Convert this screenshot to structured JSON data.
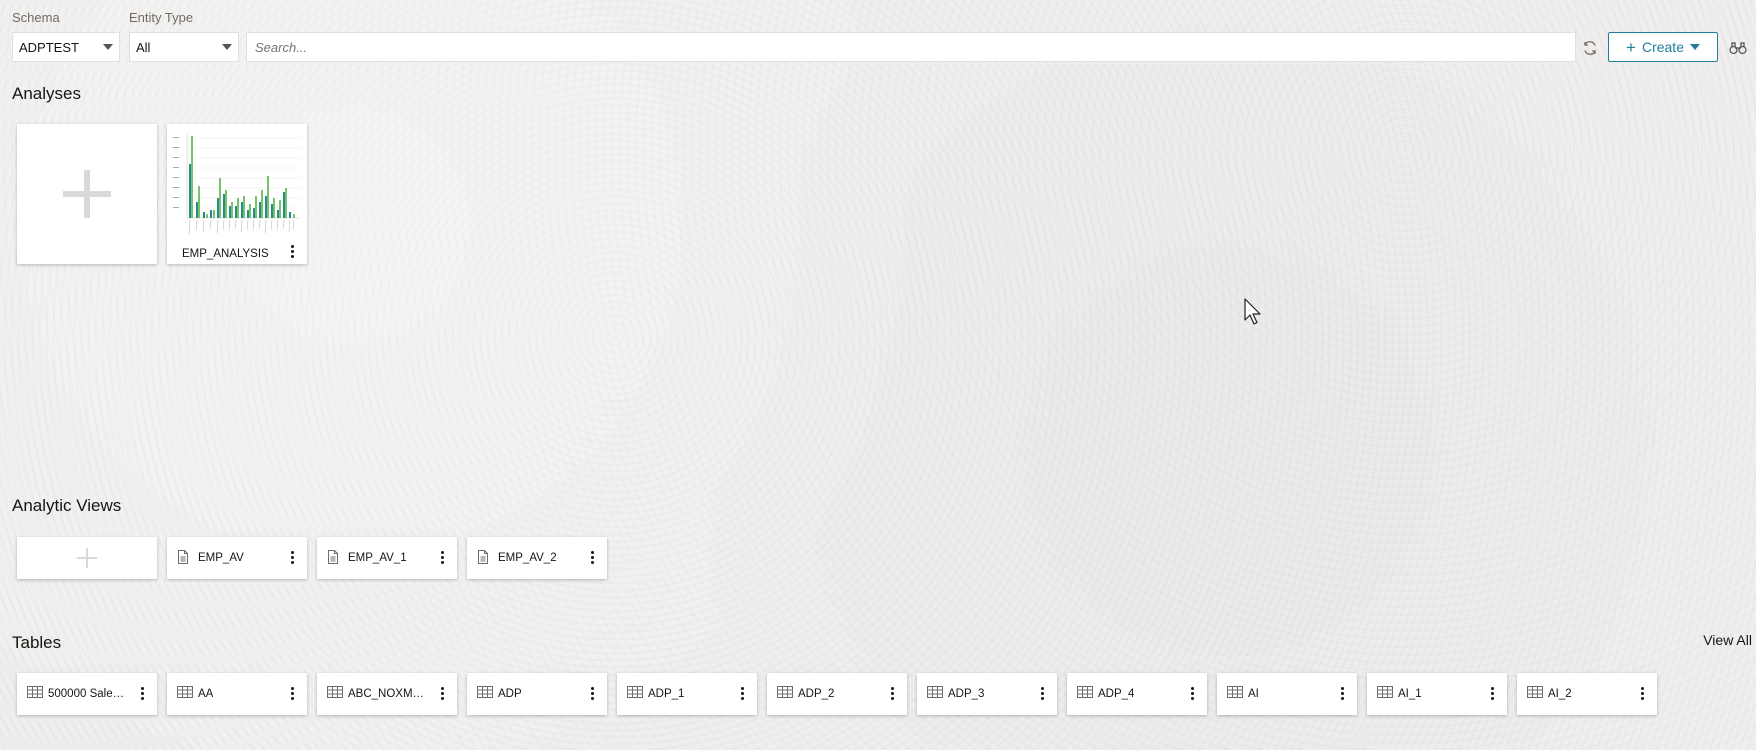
{
  "filters": {
    "schema_label": "Schema",
    "schema_value": "ADPTEST",
    "entity_type_label": "Entity Type",
    "entity_type_value": "All",
    "search_placeholder": "Search..."
  },
  "toolbar": {
    "refresh_icon": "refresh-icon",
    "create_label": "Create",
    "binoculars_icon": "binoculars-icon"
  },
  "analyses": {
    "title": "Analyses",
    "items": [
      {
        "label": "EMP_ANALYSIS"
      }
    ]
  },
  "analytic_views": {
    "title": "Analytic Views",
    "items": [
      {
        "label": "EMP_AV"
      },
      {
        "label": "EMP_AV_1"
      },
      {
        "label": "EMP_AV_2"
      }
    ]
  },
  "tables": {
    "title": "Tables",
    "view_all": "View All",
    "items": [
      {
        "label": "500000 Sales ..."
      },
      {
        "label": "AA"
      },
      {
        "label": "ABC_NOXMLNS"
      },
      {
        "label": "ADP"
      },
      {
        "label": "ADP_1"
      },
      {
        "label": "ADP_2"
      },
      {
        "label": "ADP_3"
      },
      {
        "label": "ADP_4"
      },
      {
        "label": "AI"
      },
      {
        "label": "AI_1"
      },
      {
        "label": "AI_2"
      }
    ]
  },
  "colors": {
    "accent": "#227e9e",
    "chart_bar_primary": "#2a8c8a",
    "chart_bar_secondary": "#76c36b"
  }
}
